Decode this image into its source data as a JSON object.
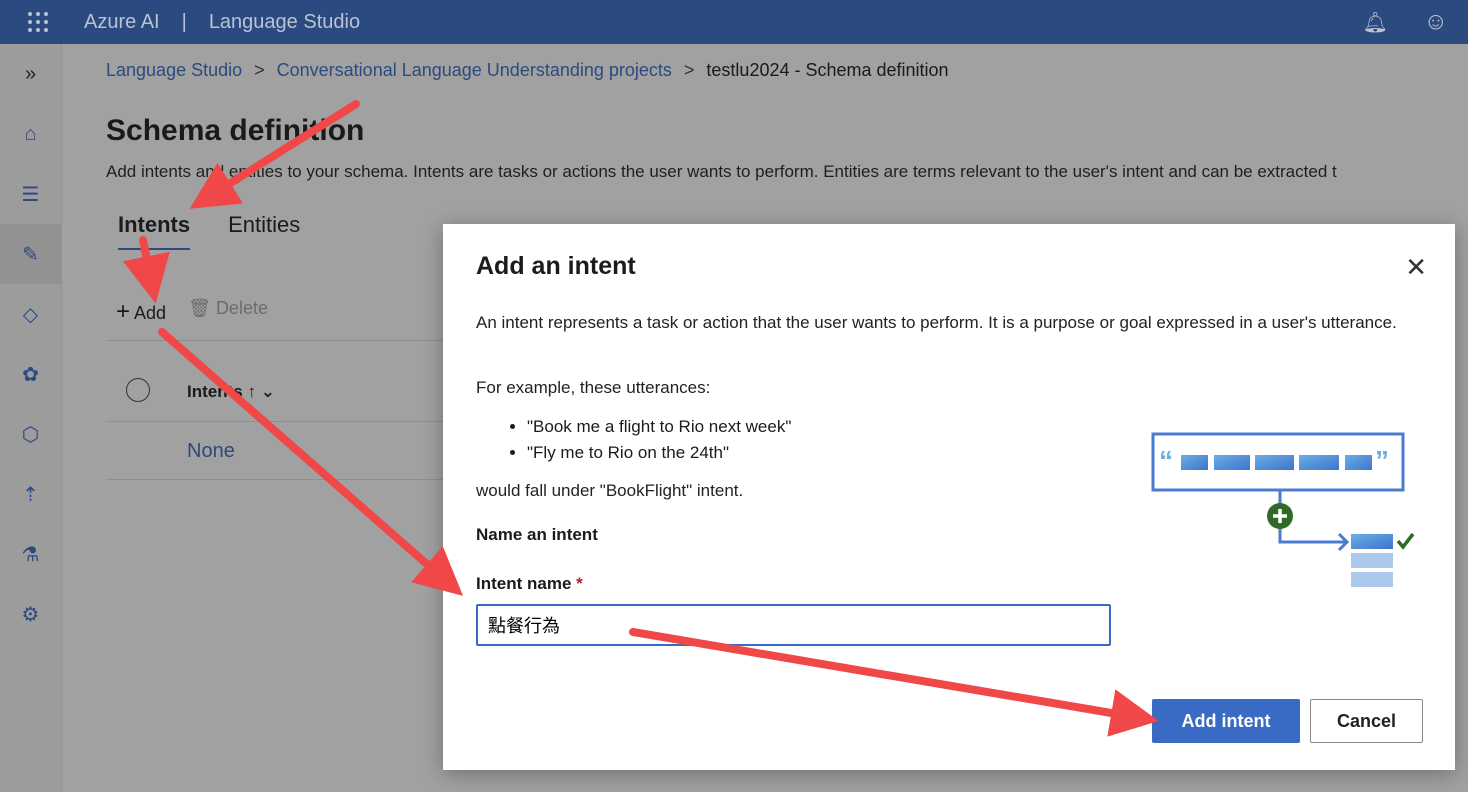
{
  "header": {
    "brand": "Azure AI",
    "divider": "|",
    "app": "Language Studio"
  },
  "breadcrumb": [
    "Language Studio",
    "Conversational Language Understanding projects",
    "testlu2024 - Schema definition"
  ],
  "page": {
    "title": "Schema definition",
    "description": "Add intents and entities to your schema. Intents are tasks or actions the user wants to perform. Entities are terms relevant to the user's intent and can be extracted t"
  },
  "tabs": [
    "Intents",
    "Entities"
  ],
  "commands": {
    "add": "Add",
    "delete": "Delete"
  },
  "table": {
    "header": "Intents",
    "sort": "↑",
    "rows": [
      "None"
    ]
  },
  "dialog": {
    "title": "Add an intent",
    "intro": "An intent represents a task or action that the user wants to perform. It is a purpose or goal expressed in a user's utterance.",
    "example_lead": "For example, these utterances:",
    "examples": [
      "\"Book me a flight to Rio next week\"",
      "\"Fly me to Rio on the 24th\""
    ],
    "example_tail": "would fall under \"BookFlight\" intent.",
    "section": "Name an intent",
    "field_label": "Intent name",
    "required": "*",
    "field_value": "點餐行為",
    "primary": "Add intent",
    "cancel": "Cancel"
  },
  "colors": {
    "header": "#2b4a80",
    "accent": "#3a6bc4",
    "annotation": "#f04848"
  }
}
